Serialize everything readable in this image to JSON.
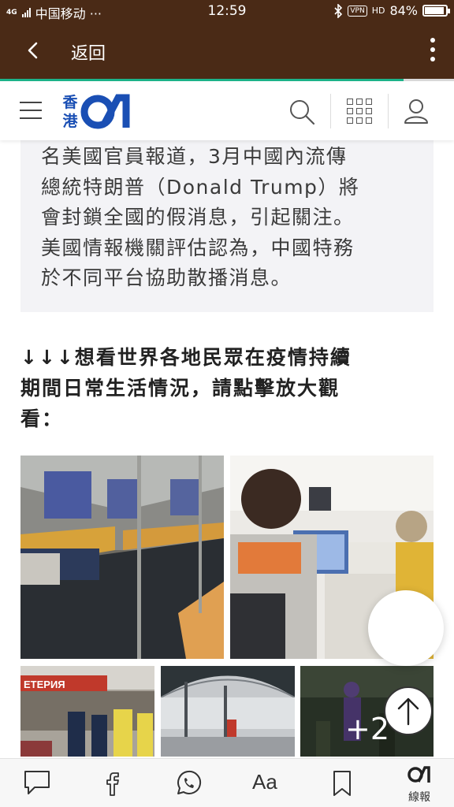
{
  "status_bar": {
    "network": "4G",
    "carrier": "中国移动 ···",
    "time": "12:59",
    "vpn": "VPN",
    "hd": "HD",
    "battery": "84%",
    "battery_level": 0.84
  },
  "app_bar": {
    "back_label": "返回"
  },
  "site_header": {
    "logo_text_top": "香",
    "logo_text_bottom": "港",
    "logo_mark": "01",
    "brand_color": "#1a4fb4"
  },
  "article": {
    "quote_lines": [
      "名美國官員報道，3月中國內流傳",
      "總統特朗普（Donald Trump）將",
      "會封鎖全國的假消息，引起關注。",
      "美國情報機關評估認為，中國特務",
      "於不同平台協助散播消息。"
    ],
    "cta_lines": [
      "↓↓↓想看世界各地民眾在疫情持續",
      "期間日常生活情況，請點擊放大觀",
      "看："
    ]
  },
  "gallery": {
    "more_count": "+2",
    "store_sign": "ЕТЕРИЯ"
  },
  "toolbar": {
    "font_label": "Aa",
    "brand_mark": "01",
    "brand_label": "線報"
  },
  "colors": {
    "app_bar": "#4a2a16",
    "progress": "#1db38a",
    "quote_bg": "#f3f3f6"
  }
}
